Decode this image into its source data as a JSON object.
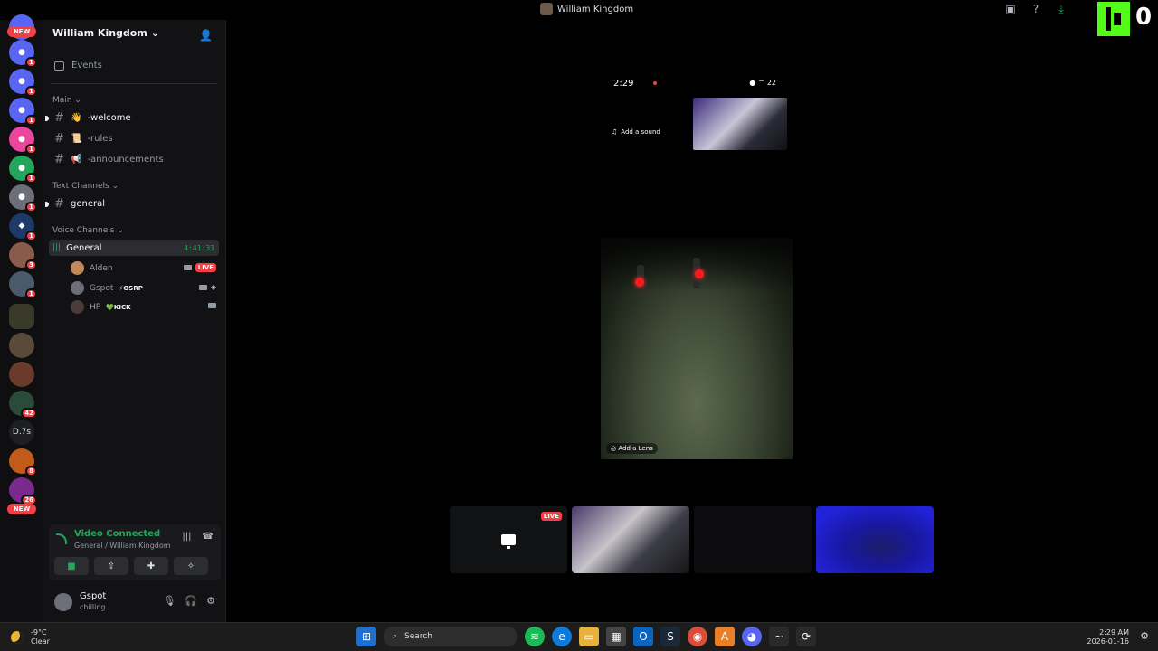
{
  "titlebar": {
    "title": "William Kingdom",
    "icons": [
      "inbox-icon",
      "help-icon",
      "download-icon"
    ],
    "kick_count": "0"
  },
  "rail": {
    "top_pill": "NEW",
    "bottom_pill": "NEW",
    "text_server": "D.7s",
    "badges": [
      "1",
      "1",
      "1",
      "1",
      "1",
      "1",
      "1",
      "3",
      "1",
      "8",
      "1",
      "42",
      "8",
      "26"
    ]
  },
  "sidebar": {
    "guild_name": "William Kingdom",
    "events_label": "Events",
    "main_category": "Main",
    "channels_main": [
      {
        "emoji": "👋",
        "name": "-welcome"
      },
      {
        "emoji": "📜",
        "name": "-rules"
      },
      {
        "emoji": "📢",
        "name": "-announcements"
      }
    ],
    "text_category": "Text Channels",
    "text_channel": "general",
    "voice_category": "Voice Channels",
    "voice_channel": "General",
    "voice_timer": "4:41:33",
    "voice_users": [
      {
        "name": "Alden",
        "tag": "",
        "badge": "LIVE"
      },
      {
        "name": "Gspot",
        "tag": "⚡OSRP",
        "badge": ""
      },
      {
        "name": "HP",
        "tag": "💚KICK",
        "badge": ""
      }
    ]
  },
  "voice_panel": {
    "status": "Video Connected",
    "location": "General / William Kingdom"
  },
  "user_panel": {
    "name": "Gspot",
    "status": "chilling"
  },
  "stage": {
    "phone_time": "2:29",
    "phone_battery": "22",
    "add_sound": "Add a sound",
    "add_lens": "Add a Lens",
    "tile_live": "LIVE"
  },
  "taskbar": {
    "temp": "-9°C",
    "weather": "Clear",
    "search": "Search",
    "time": "2:29 AM",
    "date": "2026-01-16"
  }
}
